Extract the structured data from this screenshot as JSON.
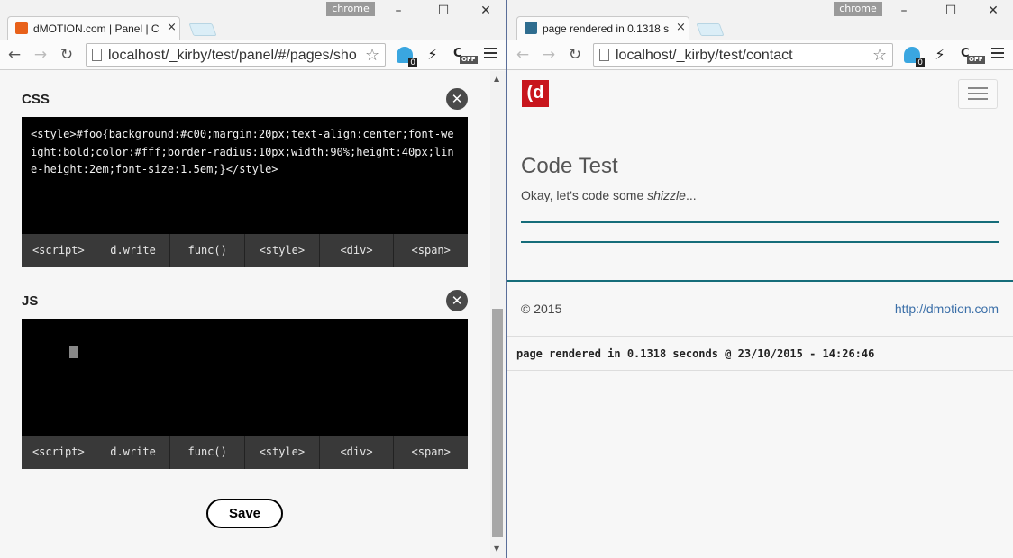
{
  "left_window": {
    "chrome_badge": "chrome",
    "tab": {
      "title": "dMOTION.com | Panel | C",
      "close": "×"
    },
    "url": "localhost/_kirby/test/panel/#/pages/sho",
    "extensions": {
      "ghost_count": "0",
      "coff_label": "C",
      "coff_off": "OFF"
    },
    "fields": [
      {
        "label": "CSS",
        "value": "<style>#foo{background:#c00;margin:20px;text-align:center;font-weight:bold;color:#fff;border-radius:10px;width:90%;height:40px;line-height:2em;font-size:1.5em;}</style>",
        "snippets": [
          "<script>",
          "d.write",
          "func()",
          "<style>",
          "<div>",
          "<span>"
        ]
      },
      {
        "label": "JS",
        "value": "",
        "snippets": [
          "<script>",
          "d.write",
          "func()",
          "<style>",
          "<div>",
          "<span>"
        ]
      }
    ],
    "save_label": "Save"
  },
  "right_window": {
    "chrome_badge": "chrome",
    "tab": {
      "title": "page rendered in 0.1318 s",
      "close": "×"
    },
    "url": "localhost/_kirby/test/contact",
    "extensions": {
      "ghost_count": "0",
      "coff_label": "C",
      "coff_off": "OFF"
    },
    "site": {
      "logo": "(d",
      "heading": "Code Test",
      "text_prefix": "Okay, let's code some ",
      "text_emph": "shizzle",
      "text_suffix": "...",
      "copyright": "© 2015",
      "link": "http://dmotion.com",
      "render_info": "page rendered in 0.1318 seconds @ 23/10/2015 - 14:26:46"
    }
  },
  "colors": {
    "brand_red": "#c8161d",
    "rule_teal": "#166d7a",
    "link_blue": "#3b6fa8"
  }
}
